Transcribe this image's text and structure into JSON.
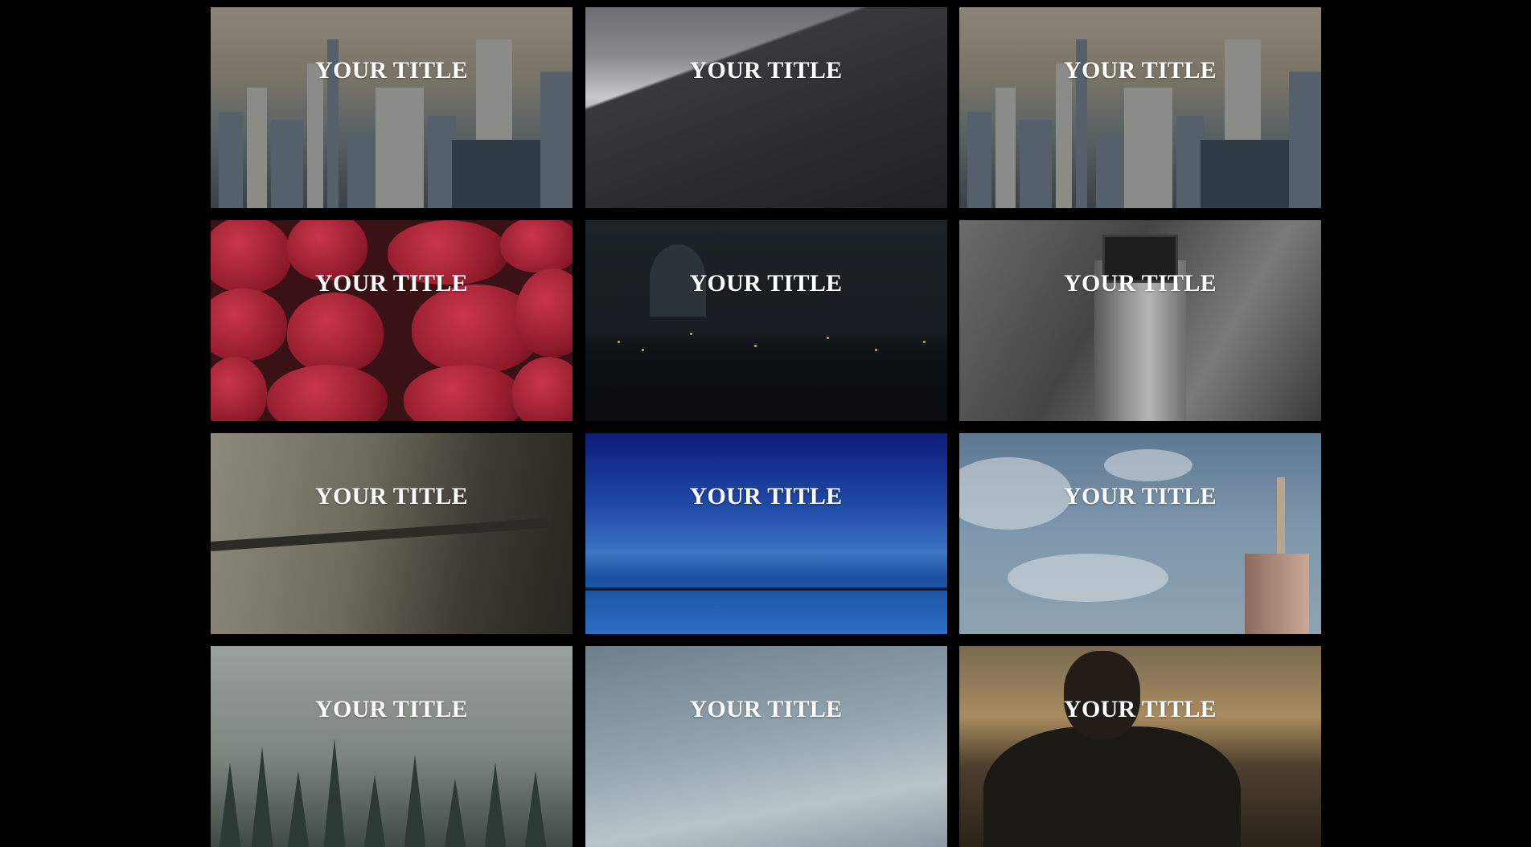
{
  "gallery": {
    "tiles": [
      {
        "title": "YOUR TITLE",
        "scene": "city skyline"
      },
      {
        "title": "YOUR TITLE",
        "scene": "mountain above clouds"
      },
      {
        "title": "YOUR TITLE",
        "scene": "city skyline"
      },
      {
        "title": "YOUR TITLE",
        "scene": "strawberries"
      },
      {
        "title": "YOUR TITLE",
        "scene": "night city bridge"
      },
      {
        "title": "YOUR TITLE",
        "scene": "lighthouse"
      },
      {
        "title": "YOUR TITLE",
        "scene": "foggy bridge"
      },
      {
        "title": "YOUR TITLE",
        "scene": "blue sea horizon"
      },
      {
        "title": "YOUR TITLE",
        "scene": "sky with skyscraper"
      },
      {
        "title": "YOUR TITLE",
        "scene": "misty forest"
      },
      {
        "title": "YOUR TITLE",
        "scene": "pale sky"
      },
      {
        "title": "YOUR TITLE",
        "scene": "person at sunset"
      }
    ]
  }
}
